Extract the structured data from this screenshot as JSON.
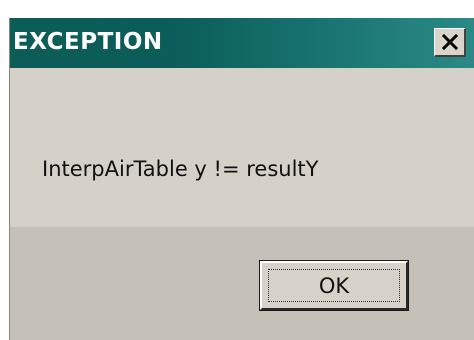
{
  "window": {
    "title": "EXCEPTION",
    "close_icon": "close-x-icon",
    "titlebar_color": "#0b5d59"
  },
  "dialog": {
    "message": "InterpAirTable y != resultY",
    "ok_label": "OK"
  }
}
